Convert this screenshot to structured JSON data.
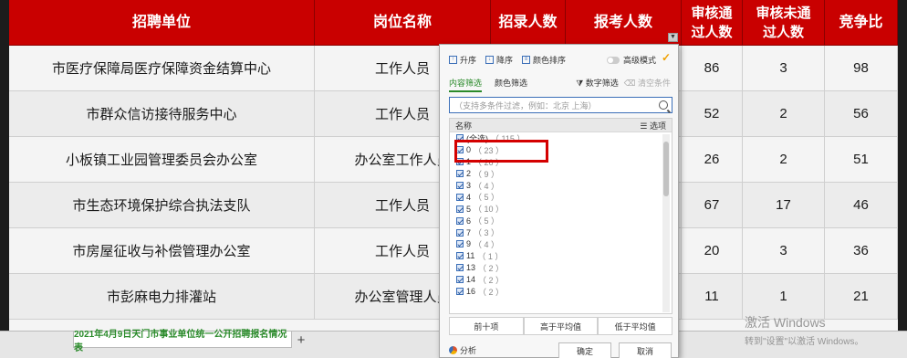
{
  "headers": {
    "unit": "招聘单位",
    "post": "岗位名称",
    "recruit": "招录人数",
    "apply": "报考人数",
    "approved": "审核通过人数",
    "rejected": "审核未通过人数",
    "ratio": "竞争比"
  },
  "rows": [
    {
      "unit": "市医疗保障局医疗保障资金结算中心",
      "post": "工作人员",
      "approved": "86",
      "rejected": "3",
      "ratio": "98"
    },
    {
      "unit": "市群众信访接待服务中心",
      "post": "工作人员",
      "approved": "52",
      "rejected": "2",
      "ratio": "56"
    },
    {
      "unit": "小板镇工业园管理委员会办公室",
      "post": "办公室工作人员",
      "approved": "26",
      "rejected": "2",
      "ratio": "51"
    },
    {
      "unit": "市生态环境保护综合执法支队",
      "post": "工作人员",
      "approved": "67",
      "rejected": "17",
      "ratio": "46"
    },
    {
      "unit": "市房屋征收与补偿管理办公室",
      "post": "工作人员",
      "approved": "20",
      "rejected": "3",
      "ratio": "36"
    },
    {
      "unit": "市彭麻电力排灌站",
      "post": "办公室管理人员",
      "approved": "11",
      "rejected": "1",
      "ratio": "21"
    }
  ],
  "filter": {
    "asc": "升序",
    "desc": "降序",
    "color_sort": "颜色排序",
    "advanced": "高级模式",
    "tab_content": "内容筛选",
    "tab_color": "颜色筛选",
    "number_filter": "数字筛选",
    "clear": "清空条件",
    "search_placeholder": "（支持多条件过滤，例如：北京  上海）",
    "list_header": "名称",
    "options": "选项",
    "items": [
      {
        "label": "(全选)",
        "count": "（ 115 ）"
      },
      {
        "label": "0",
        "count": "（ 23 ）"
      },
      {
        "label": "1",
        "count": "（ 26 ）"
      },
      {
        "label": "2",
        "count": "（ 9 ）"
      },
      {
        "label": "3",
        "count": "（ 4 ）"
      },
      {
        "label": "4",
        "count": "（ 5 ）"
      },
      {
        "label": "5",
        "count": "（ 10 ）"
      },
      {
        "label": "6",
        "count": "（ 5 ）"
      },
      {
        "label": "7",
        "count": "（ 3 ）"
      },
      {
        "label": "9",
        "count": "（ 4 ）"
      },
      {
        "label": "11",
        "count": "（ 1 ）"
      },
      {
        "label": "13",
        "count": "（ 2 ）"
      },
      {
        "label": "14",
        "count": "（ 2 ）"
      },
      {
        "label": "16",
        "count": "（ 2 ）"
      }
    ],
    "top10": "前十项",
    "above_avg": "高于平均值",
    "below_avg": "低于平均值",
    "analysis": "分析",
    "ok": "确定",
    "cancel": "取消"
  },
  "sheet_tab": "2021年4月9日天门市事业单位统一公开招聘报名情况表",
  "add_tab": "+",
  "watermark": {
    "line1": "激活 Windows",
    "line2": "转到\"设置\"以激活 Windows。"
  },
  "colors": {
    "header_red": "#c90000",
    "accent_green": "#2a8a2a",
    "highlight_red": "#d40000"
  }
}
